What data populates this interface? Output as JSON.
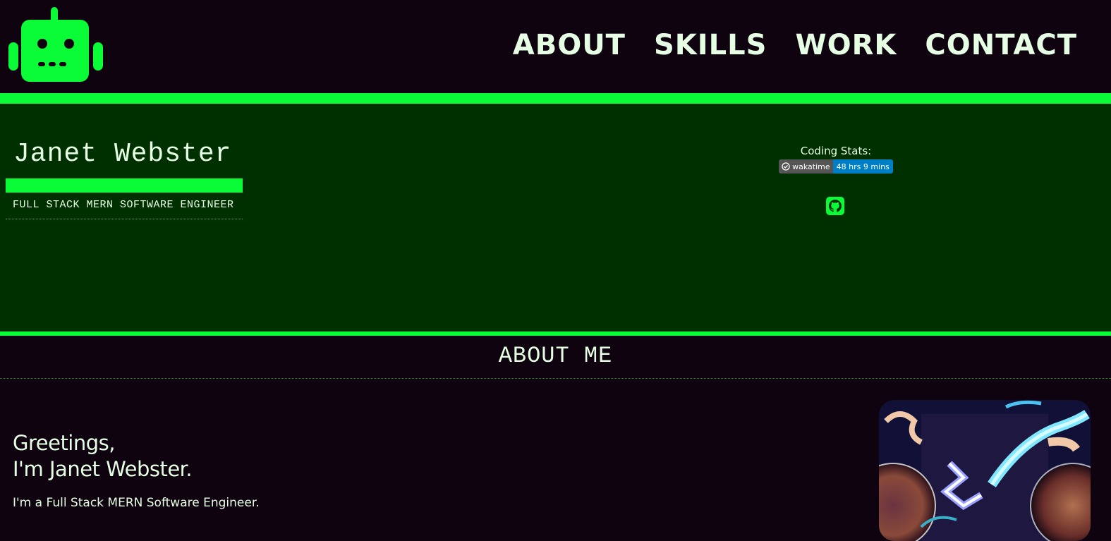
{
  "nav": {
    "items": [
      "ABOUT",
      "SKILLS",
      "WORK",
      "CONTACT"
    ]
  },
  "hero": {
    "name": "Janet Webster",
    "subtitle": "FULL STACK MERN SOFTWARE ENGINEER",
    "stats_label": "Coding Stats:",
    "badge": {
      "label": "wakatime",
      "value": "48 hrs 9 mins"
    }
  },
  "about": {
    "heading": "ABOUT ME",
    "greeting_line1": "Greetings,",
    "greeting_line2": "I'm Janet Webster.",
    "intro": "I'm a Full Stack MERN Software Engineer."
  },
  "icons": {
    "logo": "robot-icon",
    "badge": "wakatime-icon",
    "social": "github-icon"
  },
  "colors": {
    "background": "#0e030e",
    "accent": "#0afc37",
    "hero_background": "#002f00",
    "text": "#e6ffe4",
    "badge_value": "#007ec6"
  }
}
